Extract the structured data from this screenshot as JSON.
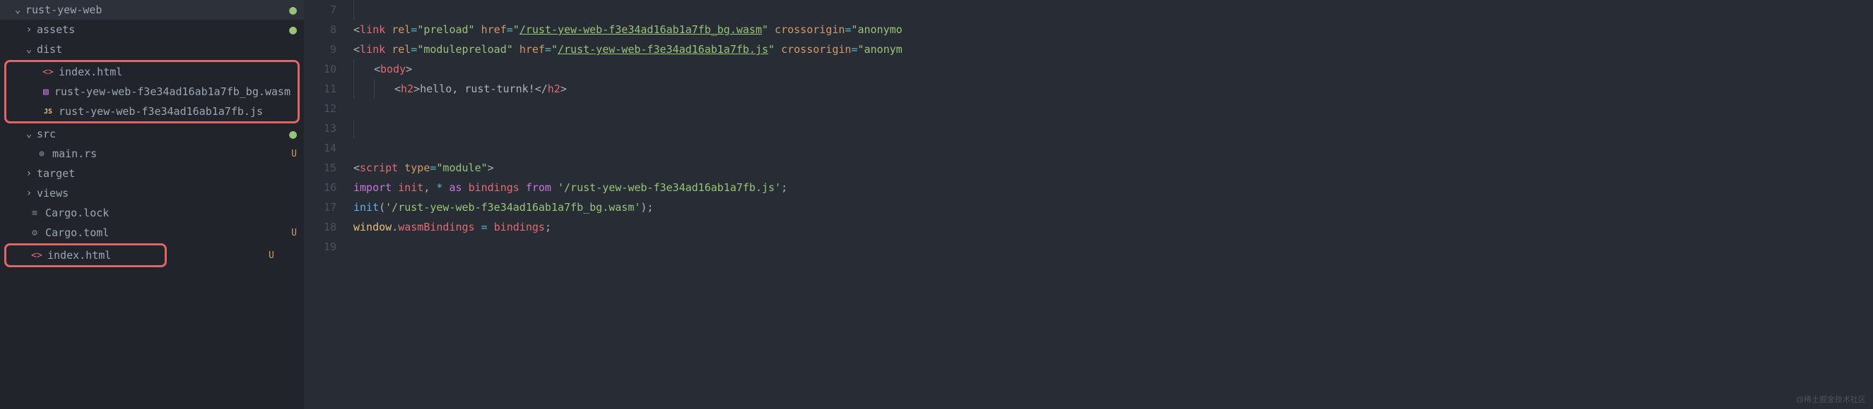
{
  "sidebar": {
    "root": {
      "label": "rust-yew-web",
      "status_dot": "●"
    },
    "assets": {
      "label": "assets",
      "status_dot": "●"
    },
    "dist": {
      "label": "dist"
    },
    "dist_files": {
      "index_html": "index.html",
      "wasm": "rust-yew-web-f3e34ad16ab1a7fb_bg.wasm",
      "js": "rust-yew-web-f3e34ad16ab1a7fb.js"
    },
    "src": {
      "label": "src",
      "status_dot": "●"
    },
    "main_rs": {
      "label": "main.rs",
      "status": "U"
    },
    "target": {
      "label": "target"
    },
    "views": {
      "label": "views"
    },
    "cargo_lock": {
      "label": "Cargo.lock"
    },
    "cargo_toml": {
      "label": "Cargo.toml",
      "status": "U"
    },
    "index_html": {
      "label": "index.html",
      "status": "U"
    }
  },
  "editor": {
    "line_numbers": [
      "7",
      "8",
      "9",
      "10",
      "11",
      "12",
      "13",
      "14",
      "15",
      "16",
      "17",
      "18",
      "19"
    ],
    "tokens": {
      "l8": {
        "lt": "<",
        "tag": "link",
        "rel": "rel",
        "eq": "=",
        "rel_v": "\"preload\"",
        "href": "href",
        "href_v_q": "\"",
        "href_v": "/rust-yew-web-f3e34ad16ab1a7fb_bg.wasm",
        "crossorigin": "crossorigin",
        "anon": "\"anonymo"
      },
      "l9": {
        "lt": "<",
        "tag": "link",
        "rel": "rel",
        "eq": "=",
        "rel_v": "\"modulepreload\"",
        "href": "href",
        "href_v_q": "\"",
        "href_v": "/rust-yew-web-f3e34ad16ab1a7fb.js",
        "crossorigin": "crossorigin",
        "anon": "\"anonym"
      },
      "l10": {
        "lt": "<",
        "tag": "body",
        "gt": ">"
      },
      "l11": {
        "lt": "<",
        "tag": "h2",
        "gt": ">",
        "text": "hello, rust-turnk!",
        "lt2": "</",
        "tag2": "h2",
        "gt2": ">"
      },
      "l15": {
        "lt": "<",
        "tag": "script",
        "type_a": "type",
        "eq": "=",
        "type_v": "\"module\"",
        "gt": ">"
      },
      "l16": {
        "import": "import",
        "init": "init",
        "c1": ", ",
        "star": "*",
        "as": " as ",
        "bindings": "bindings",
        "from": " from ",
        "path": "'/rust-yew-web-f3e34ad16ab1a7fb.js'",
        "semi": ";"
      },
      "l17": {
        "init": "init",
        "lp": "(",
        "path": "'/rust-yew-web-f3e34ad16ab1a7fb_bg.wasm'",
        "rp": ")",
        "semi": ";"
      },
      "l18": {
        "window": "window",
        "dot": ".",
        "wb": "wasmBindings",
        "eq": " = ",
        "bindings": "bindings",
        "semi": ";"
      }
    }
  },
  "watermark": "@稀土掘金技术社区",
  "icons": {
    "js_text": "JS"
  }
}
